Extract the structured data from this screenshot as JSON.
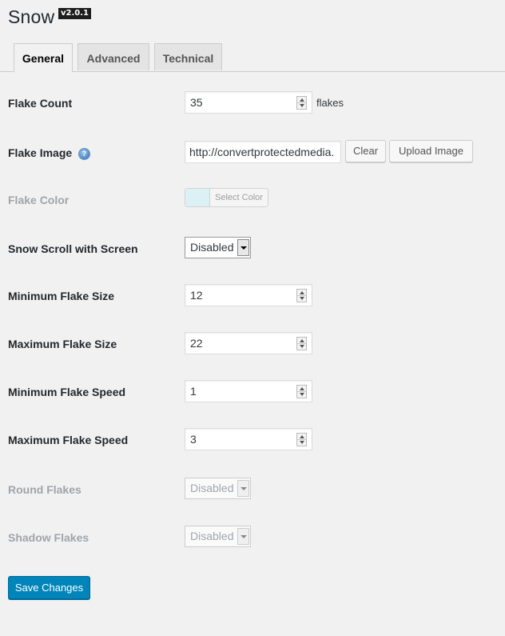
{
  "header": {
    "title": "Snow",
    "version": "v2.0.1"
  },
  "tabs": [
    {
      "label": "General",
      "active": true
    },
    {
      "label": "Advanced",
      "active": false
    },
    {
      "label": "Technical",
      "active": false
    }
  ],
  "fields": {
    "flake_count": {
      "label": "Flake Count",
      "value": "35",
      "suffix": "flakes"
    },
    "flake_image": {
      "label": "Flake Image",
      "value": "http://convertprotectedmedia.",
      "clear_label": "Clear",
      "upload_label": "Upload Image"
    },
    "flake_color": {
      "label": "Flake Color",
      "button_label": "Select Color",
      "swatch_color": "#d8f1f6"
    },
    "snow_scroll": {
      "label": "Snow Scroll with Screen",
      "value": "Disabled"
    },
    "min_flake_size": {
      "label": "Minimum Flake Size",
      "value": "12"
    },
    "max_flake_size": {
      "label": "Maximum Flake Size",
      "value": "22"
    },
    "min_flake_speed": {
      "label": "Minimum Flake Speed",
      "value": "1"
    },
    "max_flake_speed": {
      "label": "Maximum Flake Speed",
      "value": "3"
    },
    "round_flakes": {
      "label": "Round Flakes",
      "value": "Disabled"
    },
    "shadow_flakes": {
      "label": "Shadow Flakes",
      "value": "Disabled"
    }
  },
  "actions": {
    "save_label": "Save Changes"
  },
  "colors": {
    "primary_button": "#0085ba",
    "background": "#f1f1f1",
    "disabled_text": "#a0a5aa"
  }
}
